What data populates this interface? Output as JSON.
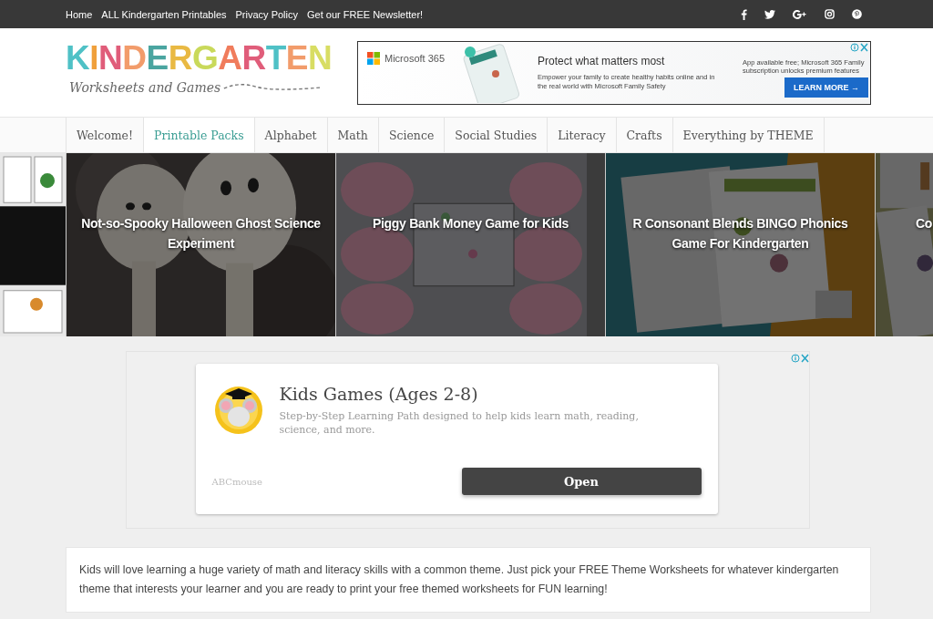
{
  "top_bar": {
    "links": [
      "Home",
      "ALL Kindergarten Printables",
      "Privacy Policy",
      "Get our FREE Newsletter!"
    ],
    "social": [
      {
        "kind": "facebook"
      },
      {
        "kind": "twitter"
      },
      {
        "kind": "googleplus"
      },
      {
        "kind": "instagram"
      },
      {
        "kind": "pinterest"
      }
    ]
  },
  "logo": {
    "title": "KINDERGARTEN",
    "subtitle": "Worksheets and Games"
  },
  "header_ad": {
    "brand": "Microsoft 365",
    "headline": "Protect what matters most",
    "body": "Empower your family to create healthy habits online and in the real world with Microsoft Family Safety",
    "fine_print": "App available free; Microsoft 365 Family subscription unlocks premium features",
    "button": "LEARN MORE →"
  },
  "nav": [
    {
      "label": "Welcome!",
      "selected": false
    },
    {
      "label": "Printable Packs",
      "selected": true
    },
    {
      "label": "Alphabet",
      "selected": false
    },
    {
      "label": "Math",
      "selected": false
    },
    {
      "label": "Science",
      "selected": false
    },
    {
      "label": "Social Studies",
      "selected": false
    },
    {
      "label": "Literacy",
      "selected": false
    },
    {
      "label": "Crafts",
      "selected": false
    },
    {
      "label": "Everything by THEME",
      "selected": false
    }
  ],
  "slides": [
    {
      "kind": "partial-left"
    },
    {
      "kind": "ghost",
      "caption": "Not-so-Spooky Halloween Ghost Science Experiment"
    },
    {
      "kind": "piggy",
      "caption": "Piggy Bank Money Game for Kids"
    },
    {
      "kind": "bingo",
      "caption": "R Consonant Blends BINGO Phonics Game For Kindergarten"
    },
    {
      "kind": "partial-right",
      "caption": "Co"
    }
  ],
  "ad": {
    "title": "Kids Games (Ages 2-8)",
    "body": "Step-by-Step Learning Path designed to help kids learn math, reading, science, and more.",
    "advertiser": "ABCmouse",
    "button": "Open"
  },
  "intro": "Kids will love learning a huge variety of math and literacy skills with a common theme. Just pick your FREE Theme Worksheets for whatever kindergarten theme that interests your learner and you are ready to print your free themed worksheets for FUN learning!"
}
